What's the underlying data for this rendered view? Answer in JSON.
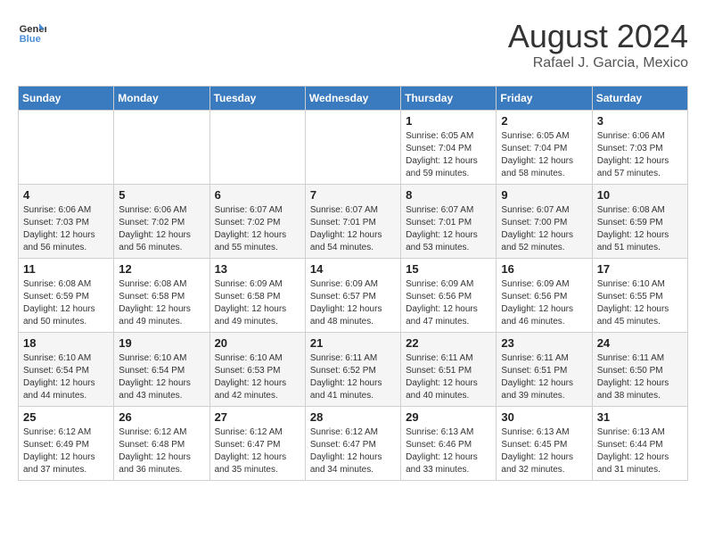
{
  "header": {
    "logo_line1": "General",
    "logo_line2": "Blue",
    "title": "August 2024",
    "subtitle": "Rafael J. Garcia, Mexico"
  },
  "days_of_week": [
    "Sunday",
    "Monday",
    "Tuesday",
    "Wednesday",
    "Thursday",
    "Friday",
    "Saturday"
  ],
  "weeks": [
    {
      "days": [
        {
          "num": "",
          "empty": true
        },
        {
          "num": "",
          "empty": true
        },
        {
          "num": "",
          "empty": true
        },
        {
          "num": "",
          "empty": true
        },
        {
          "num": "1",
          "sunrise": "6:05 AM",
          "sunset": "7:04 PM",
          "daylight": "12 hours and 59 minutes."
        },
        {
          "num": "2",
          "sunrise": "6:05 AM",
          "sunset": "7:04 PM",
          "daylight": "12 hours and 58 minutes."
        },
        {
          "num": "3",
          "sunrise": "6:06 AM",
          "sunset": "7:03 PM",
          "daylight": "12 hours and 57 minutes."
        }
      ]
    },
    {
      "days": [
        {
          "num": "4",
          "sunrise": "6:06 AM",
          "sunset": "7:03 PM",
          "daylight": "12 hours and 56 minutes."
        },
        {
          "num": "5",
          "sunrise": "6:06 AM",
          "sunset": "7:02 PM",
          "daylight": "12 hours and 56 minutes."
        },
        {
          "num": "6",
          "sunrise": "6:07 AM",
          "sunset": "7:02 PM",
          "daylight": "12 hours and 55 minutes."
        },
        {
          "num": "7",
          "sunrise": "6:07 AM",
          "sunset": "7:01 PM",
          "daylight": "12 hours and 54 minutes."
        },
        {
          "num": "8",
          "sunrise": "6:07 AM",
          "sunset": "7:01 PM",
          "daylight": "12 hours and 53 minutes."
        },
        {
          "num": "9",
          "sunrise": "6:07 AM",
          "sunset": "7:00 PM",
          "daylight": "12 hours and 52 minutes."
        },
        {
          "num": "10",
          "sunrise": "6:08 AM",
          "sunset": "6:59 PM",
          "daylight": "12 hours and 51 minutes."
        }
      ]
    },
    {
      "days": [
        {
          "num": "11",
          "sunrise": "6:08 AM",
          "sunset": "6:59 PM",
          "daylight": "12 hours and 50 minutes."
        },
        {
          "num": "12",
          "sunrise": "6:08 AM",
          "sunset": "6:58 PM",
          "daylight": "12 hours and 49 minutes."
        },
        {
          "num": "13",
          "sunrise": "6:09 AM",
          "sunset": "6:58 PM",
          "daylight": "12 hours and 49 minutes."
        },
        {
          "num": "14",
          "sunrise": "6:09 AM",
          "sunset": "6:57 PM",
          "daylight": "12 hours and 48 minutes."
        },
        {
          "num": "15",
          "sunrise": "6:09 AM",
          "sunset": "6:56 PM",
          "daylight": "12 hours and 47 minutes."
        },
        {
          "num": "16",
          "sunrise": "6:09 AM",
          "sunset": "6:56 PM",
          "daylight": "12 hours and 46 minutes."
        },
        {
          "num": "17",
          "sunrise": "6:10 AM",
          "sunset": "6:55 PM",
          "daylight": "12 hours and 45 minutes."
        }
      ]
    },
    {
      "days": [
        {
          "num": "18",
          "sunrise": "6:10 AM",
          "sunset": "6:54 PM",
          "daylight": "12 hours and 44 minutes."
        },
        {
          "num": "19",
          "sunrise": "6:10 AM",
          "sunset": "6:54 PM",
          "daylight": "12 hours and 43 minutes."
        },
        {
          "num": "20",
          "sunrise": "6:10 AM",
          "sunset": "6:53 PM",
          "daylight": "12 hours and 42 minutes."
        },
        {
          "num": "21",
          "sunrise": "6:11 AM",
          "sunset": "6:52 PM",
          "daylight": "12 hours and 41 minutes."
        },
        {
          "num": "22",
          "sunrise": "6:11 AM",
          "sunset": "6:51 PM",
          "daylight": "12 hours and 40 minutes."
        },
        {
          "num": "23",
          "sunrise": "6:11 AM",
          "sunset": "6:51 PM",
          "daylight": "12 hours and 39 minutes."
        },
        {
          "num": "24",
          "sunrise": "6:11 AM",
          "sunset": "6:50 PM",
          "daylight": "12 hours and 38 minutes."
        }
      ]
    },
    {
      "days": [
        {
          "num": "25",
          "sunrise": "6:12 AM",
          "sunset": "6:49 PM",
          "daylight": "12 hours and 37 minutes."
        },
        {
          "num": "26",
          "sunrise": "6:12 AM",
          "sunset": "6:48 PM",
          "daylight": "12 hours and 36 minutes."
        },
        {
          "num": "27",
          "sunrise": "6:12 AM",
          "sunset": "6:47 PM",
          "daylight": "12 hours and 35 minutes."
        },
        {
          "num": "28",
          "sunrise": "6:12 AM",
          "sunset": "6:47 PM",
          "daylight": "12 hours and 34 minutes."
        },
        {
          "num": "29",
          "sunrise": "6:13 AM",
          "sunset": "6:46 PM",
          "daylight": "12 hours and 33 minutes."
        },
        {
          "num": "30",
          "sunrise": "6:13 AM",
          "sunset": "6:45 PM",
          "daylight": "12 hours and 32 minutes."
        },
        {
          "num": "31",
          "sunrise": "6:13 AM",
          "sunset": "6:44 PM",
          "daylight": "12 hours and 31 minutes."
        }
      ]
    }
  ]
}
